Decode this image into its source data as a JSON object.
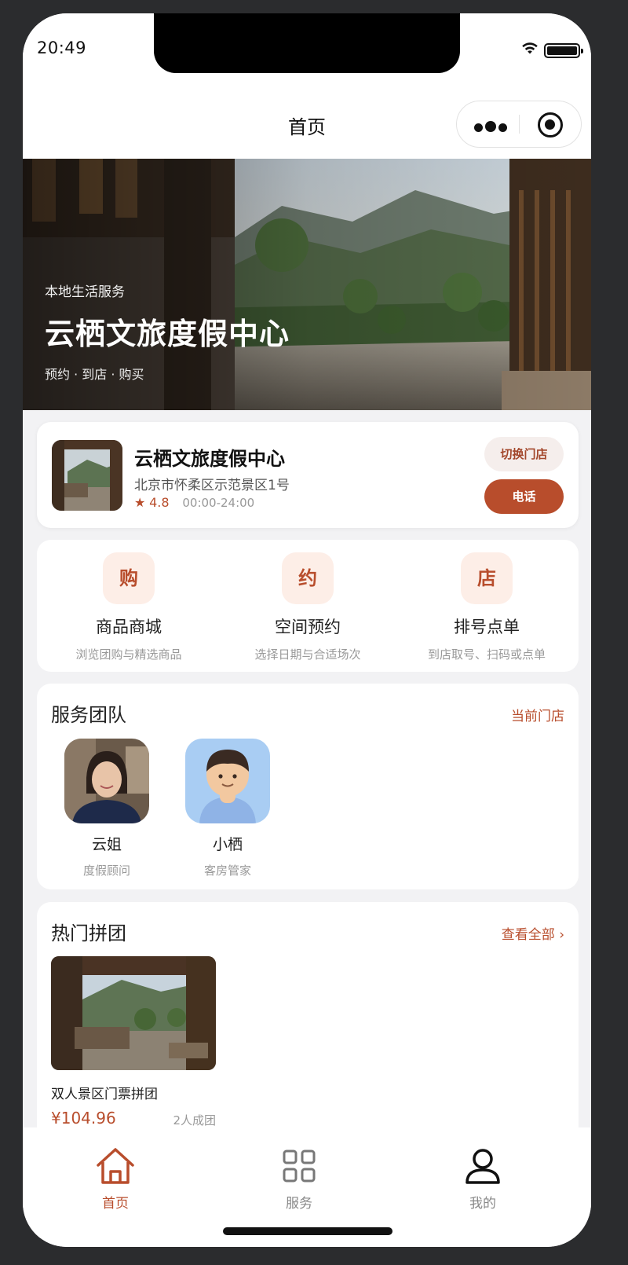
{
  "status_bar": {
    "time": "20:49"
  },
  "nav": {
    "title": "首页"
  },
  "hero": {
    "subtitle": "本地生活服务",
    "title": "云栖文旅度假中心",
    "tags": "预约 · 到店 · 购买"
  },
  "store": {
    "name": "云栖文旅度假中心",
    "address": "北京市怀柔区示范景区1号",
    "rating": "4.8",
    "hours": "00:00-24:00",
    "switch_label": "切换门店",
    "call_label": "电话"
  },
  "functions": [
    {
      "icon_char": "购",
      "title": "商品商城",
      "desc": "浏览团购与精选商品"
    },
    {
      "icon_char": "约",
      "title": "空间预约",
      "desc": "选择日期与合适场次"
    },
    {
      "icon_char": "店",
      "title": "排号点单",
      "desc": "到店取号、扫码或点单"
    }
  ],
  "team": {
    "title": "服务团队",
    "link": "当前门店",
    "members": [
      {
        "name": "云姐",
        "role": "度假顾问"
      },
      {
        "name": "小栖",
        "role": "客房管家"
      }
    ]
  },
  "group_buy": {
    "title": "热门拼团",
    "link": "查看全部 ›",
    "deals": [
      {
        "name": "双人景区门票拼团",
        "price": "¥104.96",
        "note": "2人成团"
      }
    ]
  },
  "tabbar": {
    "items": [
      {
        "label": "首页",
        "icon": "home-icon",
        "active": true
      },
      {
        "label": "服务",
        "icon": "grid-icon",
        "active": false
      },
      {
        "label": "我的",
        "icon": "user-icon",
        "active": false
      }
    ]
  },
  "colors": {
    "accent": "#b84d2c",
    "accent_light": "#fdeee7",
    "background": "#f2f2f4"
  }
}
